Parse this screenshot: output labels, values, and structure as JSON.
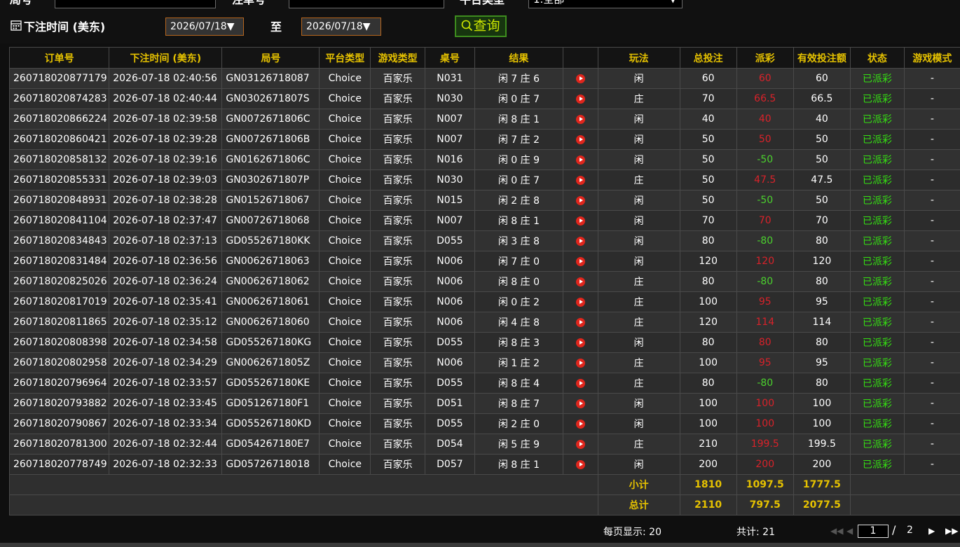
{
  "filters": {
    "row1": {
      "label_a": "局号",
      "label_b": "注单号",
      "label_c": "平台类型",
      "platform_select": "1.全部"
    },
    "bet_time_label": "下注时间 (美东)",
    "date_from": "2026/07/18",
    "to_label": "至",
    "date_to": "2026/07/18",
    "query_label": "查询"
  },
  "table": {
    "headers": [
      "订单号",
      "下注时间 (美东)",
      "局号",
      "平台类型",
      "游戏类型",
      "桌号",
      "结果",
      "",
      "玩法",
      "总投注",
      "派彩",
      "有效投注额",
      "状态",
      "游戏模式"
    ],
    "rows": [
      [
        "260718020877179",
        "2026-07-18 02:40:56",
        "GN03126718087",
        "Choice",
        "百家乐",
        "N031",
        "闲 7 庄 6",
        "闲",
        "60",
        "60",
        "60",
        "已派彩",
        "-"
      ],
      [
        "260718020874283",
        "2026-07-18 02:40:44",
        "GN0302671807S",
        "Choice",
        "百家乐",
        "N030",
        "闲 0 庄 7",
        "庄",
        "70",
        "66.5",
        "66.5",
        "已派彩",
        "-"
      ],
      [
        "260718020866224",
        "2026-07-18 02:39:58",
        "GN0072671806C",
        "Choice",
        "百家乐",
        "N007",
        "闲 8 庄 1",
        "闲",
        "40",
        "40",
        "40",
        "已派彩",
        "-"
      ],
      [
        "260718020860421",
        "2026-07-18 02:39:28",
        "GN0072671806B",
        "Choice",
        "百家乐",
        "N007",
        "闲 7 庄 2",
        "闲",
        "50",
        "50",
        "50",
        "已派彩",
        "-"
      ],
      [
        "260718020858132",
        "2026-07-18 02:39:16",
        "GN0162671806C",
        "Choice",
        "百家乐",
        "N016",
        "闲 0 庄 9",
        "闲",
        "50",
        "-50",
        "50",
        "已派彩",
        "-"
      ],
      [
        "260718020855331",
        "2026-07-18 02:39:03",
        "GN0302671807P",
        "Choice",
        "百家乐",
        "N030",
        "闲 0 庄 7",
        "庄",
        "50",
        "47.5",
        "47.5",
        "已派彩",
        "-"
      ],
      [
        "260718020848931",
        "2026-07-18 02:38:28",
        "GN01526718067",
        "Choice",
        "百家乐",
        "N015",
        "闲 2 庄 8",
        "闲",
        "50",
        "-50",
        "50",
        "已派彩",
        "-"
      ],
      [
        "260718020841104",
        "2026-07-18 02:37:47",
        "GN00726718068",
        "Choice",
        "百家乐",
        "N007",
        "闲 8 庄 1",
        "闲",
        "70",
        "70",
        "70",
        "已派彩",
        "-"
      ],
      [
        "260718020834843",
        "2026-07-18 02:37:13",
        "GD055267180KK",
        "Choice",
        "百家乐",
        "D055",
        "闲 3 庄 8",
        "闲",
        "80",
        "-80",
        "80",
        "已派彩",
        "-"
      ],
      [
        "260718020831484",
        "2026-07-18 02:36:56",
        "GN00626718063",
        "Choice",
        "百家乐",
        "N006",
        "闲 7 庄 0",
        "闲",
        "120",
        "120",
        "120",
        "已派彩",
        "-"
      ],
      [
        "260718020825026",
        "2026-07-18 02:36:24",
        "GN00626718062",
        "Choice",
        "百家乐",
        "N006",
        "闲 8 庄 0",
        "庄",
        "80",
        "-80",
        "80",
        "已派彩",
        "-"
      ],
      [
        "260718020817019",
        "2026-07-18 02:35:41",
        "GN00626718061",
        "Choice",
        "百家乐",
        "N006",
        "闲 0 庄 2",
        "庄",
        "100",
        "95",
        "95",
        "已派彩",
        "-"
      ],
      [
        "260718020811865",
        "2026-07-18 02:35:12",
        "GN00626718060",
        "Choice",
        "百家乐",
        "N006",
        "闲 4 庄 8",
        "庄",
        "120",
        "114",
        "114",
        "已派彩",
        "-"
      ],
      [
        "260718020808398",
        "2026-07-18 02:34:58",
        "GD055267180KG",
        "Choice",
        "百家乐",
        "D055",
        "闲 8 庄 3",
        "闲",
        "80",
        "80",
        "80",
        "已派彩",
        "-"
      ],
      [
        "260718020802958",
        "2026-07-18 02:34:29",
        "GN0062671805Z",
        "Choice",
        "百家乐",
        "N006",
        "闲 1 庄 2",
        "庄",
        "100",
        "95",
        "95",
        "已派彩",
        "-"
      ],
      [
        "260718020796964",
        "2026-07-18 02:33:57",
        "GD055267180KE",
        "Choice",
        "百家乐",
        "D055",
        "闲 8 庄 4",
        "庄",
        "80",
        "-80",
        "80",
        "已派彩",
        "-"
      ],
      [
        "260718020793882",
        "2026-07-18 02:33:45",
        "GD051267180F1",
        "Choice",
        "百家乐",
        "D051",
        "闲 8 庄 7",
        "闲",
        "100",
        "100",
        "100",
        "已派彩",
        "-"
      ],
      [
        "260718020790867",
        "2026-07-18 02:33:34",
        "GD055267180KD",
        "Choice",
        "百家乐",
        "D055",
        "闲 2 庄 0",
        "闲",
        "100",
        "100",
        "100",
        "已派彩",
        "-"
      ],
      [
        "260718020781300",
        "2026-07-18 02:32:44",
        "GD054267180E7",
        "Choice",
        "百家乐",
        "D054",
        "闲 5 庄 9",
        "庄",
        "210",
        "199.5",
        "199.5",
        "已派彩",
        "-"
      ],
      [
        "260718020778749",
        "2026-07-18 02:32:33",
        "GD05726718018",
        "Choice",
        "百家乐",
        "D057",
        "闲 8 庄 1",
        "闲",
        "200",
        "200",
        "200",
        "已派彩",
        "-"
      ]
    ],
    "subtotal": {
      "label": "小计",
      "total_bet": "1810",
      "payout": "1097.5",
      "valid_bet": "1777.5"
    },
    "total": {
      "label": "总计",
      "total_bet": "2110",
      "payout": "797.5",
      "valid_bet": "2077.5"
    }
  },
  "footer": {
    "per_page": "每页显示: 20",
    "total_count": "共计: 21",
    "current_page": "1",
    "separator": "/",
    "total_pages": "2"
  },
  "colors": {
    "accent": "#e6c200",
    "negative": "#4bd12e",
    "positive": "#d9222a",
    "status": "#35e012"
  }
}
